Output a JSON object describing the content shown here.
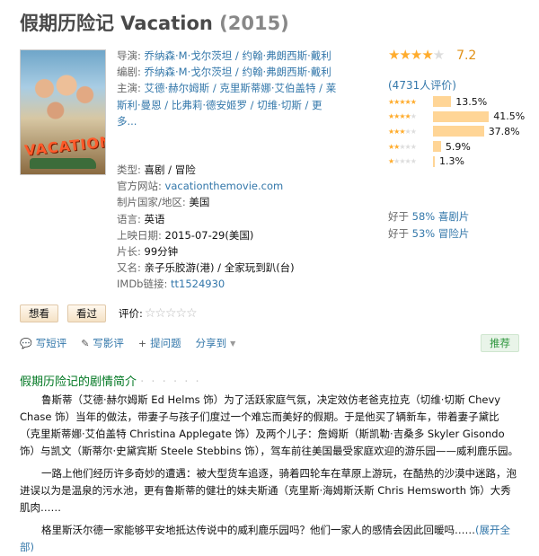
{
  "movie": {
    "title": "假期历险记 Vacation",
    "year": "(2015)"
  },
  "poster": {
    "title_art": "VACATION"
  },
  "info": {
    "director_label": "导演:",
    "director": "乔纳森·M·戈尔茨坦 / 约翰·弗朗西斯·戴利",
    "writer_label": "编剧:",
    "writer": "乔纳森·M·戈尔茨坦 / 约翰·弗朗西斯·戴利",
    "cast_label": "主演:",
    "cast": "艾德·赫尔姆斯 / 克里斯蒂娜·艾伯盖特 / 莱斯利·曼恩 / 比弗莉·德安姬罗 / 切维·切斯 / 更多...",
    "genre_label": "类型:",
    "genre": "喜剧 / 冒险",
    "site_label": "官方网站:",
    "site": "vacationthemovie.com",
    "country_label": "制片国家/地区:",
    "country": "美国",
    "language_label": "语言:",
    "language": "英语",
    "release_label": "上映日期:",
    "release": "2015-07-29(美国)",
    "runtime_label": "片长:",
    "runtime": "99分钟",
    "aka_label": "又名:",
    "aka": "亲子乐胶游(港) / 全家玩到趴(台)",
    "imdb_label": "IMDb链接:",
    "imdb": "tt1524930"
  },
  "rating": {
    "stars": 3.5,
    "score": "7.2",
    "votes": "(4731人评价)",
    "distribution": [
      {
        "stars": 5,
        "percent": 13.5,
        "label": "13.5%"
      },
      {
        "stars": 4,
        "percent": 41.5,
        "label": "41.5%"
      },
      {
        "stars": 3,
        "percent": 37.8,
        "label": "37.8%"
      },
      {
        "stars": 2,
        "percent": 5.9,
        "label": "5.9%"
      },
      {
        "stars": 1,
        "percent": 1.3,
        "label": "1.3%"
      }
    ],
    "better_than": [
      {
        "prefix": "好于",
        "value": "58% 喜剧片"
      },
      {
        "prefix": "好于",
        "value": "53% 冒险片"
      }
    ]
  },
  "actions": {
    "want": "想看",
    "seen": "看过",
    "rate_label": "评价:"
  },
  "toolbar": {
    "short_review": "写短评",
    "review": "写影评",
    "question": "提问题",
    "share": "分享到",
    "recommend": "推荐"
  },
  "summary": {
    "heading": "假期历险记的剧情简介",
    "dots": "· · · · · ·",
    "para1": "鲁斯蒂（艾德·赫尔姆斯 Ed Helms 饰）为了活跃家庭气氛，决定效仿老爸克拉克（切维·切斯 Chevy Chase 饰）当年的做法，带妻子与孩子们度过一个难忘而美好的假期。于是他买了辆新车，带着妻子黛比（克里斯蒂娜·艾伯盖特 Christina Applegate 饰）及两个儿子：詹姆斯（斯凯勒·吉桑多 Skyler Gisondo 饰）与凯文（斯蒂尔·史黛宾斯 Steele Stebbins 饰），驾车前往美国最受家庭欢迎的游乐园——威利鹿乐园。",
    "para2": "一路上他们经历许多奇妙的遭遇：被大型货车追逐，骑着四轮车在草原上游玩，在酷热的沙漠中迷路，泡进误以为是温泉的污水池，更有鲁斯蒂的健壮的妹夫斯通（克里斯·海姆斯沃斯 Chris Hemsworth 饰）大秀肌肉……",
    "para3": "格里斯沃尔德一家能够平安地抵达传说中的威利鹿乐园吗？他们一家人的感情会因此回暖吗……",
    "expand": "(展开全部)"
  }
}
